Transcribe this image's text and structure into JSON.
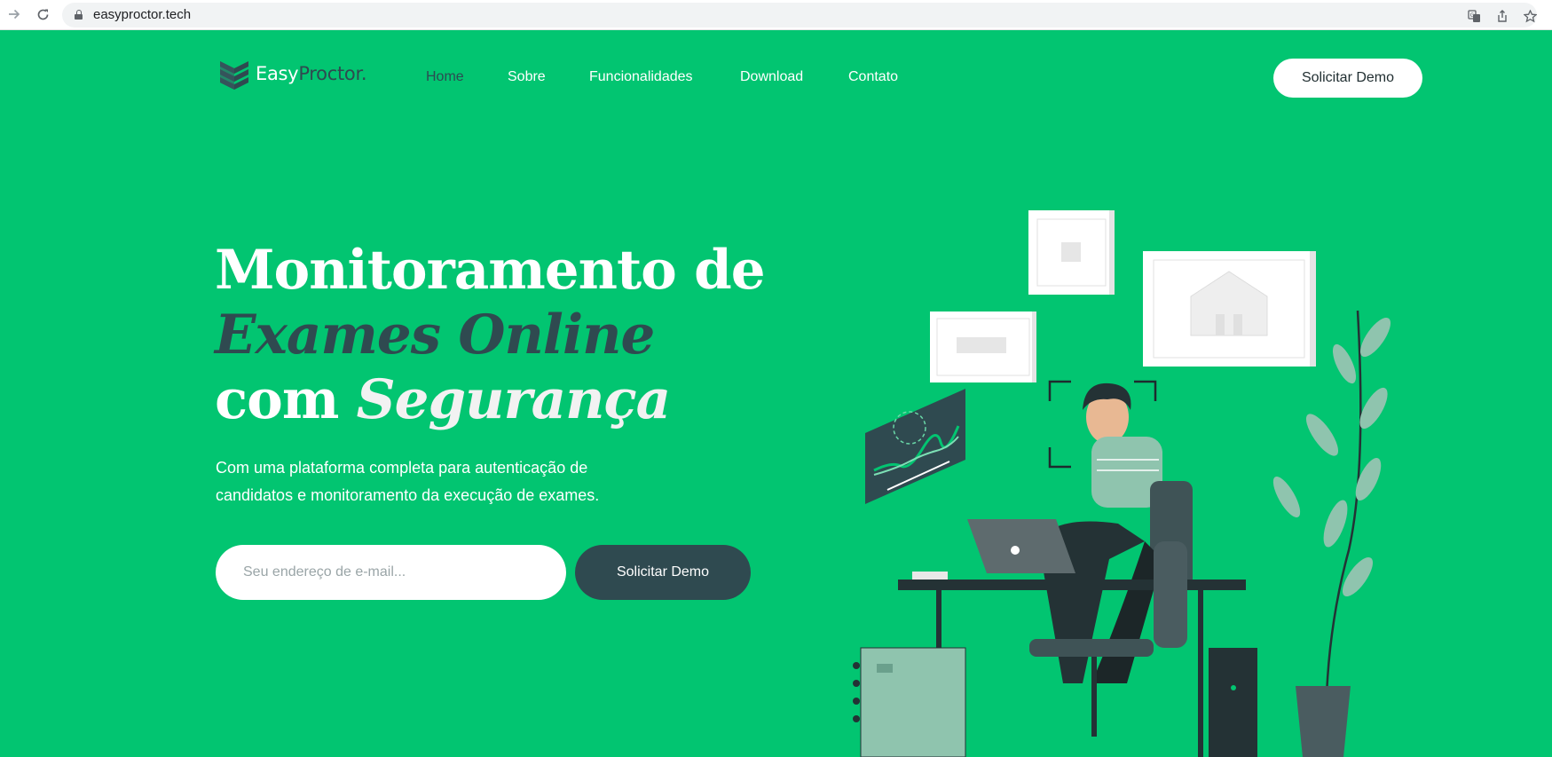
{
  "browser": {
    "url": "easyproctor.tech",
    "icons": [
      "forward-arrow-icon",
      "reload-icon",
      "lock-icon",
      "translate-icon",
      "share-icon",
      "bookmark-star-icon"
    ]
  },
  "logo": {
    "part1": "Easy",
    "part2": "Proctor."
  },
  "nav": {
    "items": [
      {
        "label": "Home",
        "active": true
      },
      {
        "label": "Sobre",
        "active": false
      },
      {
        "label": "Funcionalidades",
        "active": false
      },
      {
        "label": "Download",
        "active": false
      },
      {
        "label": "Contato",
        "active": false
      }
    ]
  },
  "header": {
    "cta_label": "Solicitar Demo"
  },
  "hero": {
    "line1": "Monitoramento de",
    "line2": "Exames Online",
    "line3_prefix": "com",
    "line3_emphasis": "Segurança",
    "subtitle_line1": "Com uma plataforma completa para autenticação de",
    "subtitle_line2": "candidatos e monitoramento da execução de exames.",
    "email_placeholder": "Seu endereço de e-mail...",
    "cta_label": "Solicitar Demo"
  },
  "colors": {
    "brand_green": "#02c571",
    "dark_teal": "#2f4a50",
    "white": "#ffffff"
  }
}
